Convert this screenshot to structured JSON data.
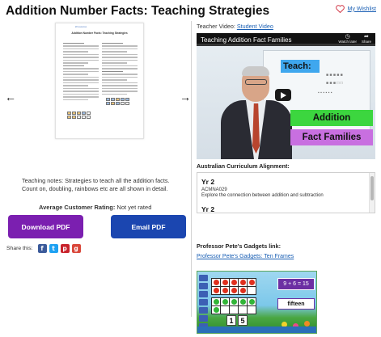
{
  "header": {
    "title": "Addition Number Facts: Teaching Strategies",
    "wishlist_label": "My Wishlist"
  },
  "preview": {
    "doc_link": "k8 resources",
    "doc_heading": "Addition Number Facts: Teaching Strategies",
    "prev_label": "◀",
    "next_label": "▶"
  },
  "description": "Teaching notes: Strategies to teach all the addition facts. Count on, doubling, rainbows etc are all shown in detail.",
  "rating": {
    "label": "Average Customer Rating:",
    "value": "Not yet rated"
  },
  "buttons": {
    "download_pdf": "Download PDF",
    "email_pdf": "Email PDF"
  },
  "share": {
    "label": "Share this:",
    "icons": [
      "facebook-icon",
      "twitter-icon",
      "pinterest-icon",
      "google-plus-icon"
    ]
  },
  "video": {
    "caption_prefix": "Teacher Video:",
    "student_link": "Student Video",
    "title": "Teaching Addition Fact Families",
    "watch_later": "Watch later",
    "share": "Share",
    "banner_teach": "Teach:",
    "label_addition": "Addition",
    "label_fact_families": "Fact Families"
  },
  "curriculum": {
    "title": "Australian Curriculum Alignment:",
    "entries": [
      {
        "year": "Yr 2",
        "code": "ACMNA029",
        "description": "Explore the connection between addition and subtraction"
      },
      {
        "year": "Yr 2"
      }
    ]
  },
  "gadgets": {
    "title": "Professor Pete's Gadgets link:",
    "link": "Professor Pete's Gadgets: Ten Frames",
    "equation": "9 + 6 = 15",
    "answer": "fifteen",
    "digits": [
      "1",
      "5"
    ]
  },
  "colors": {
    "download_button": "#7b1fb0",
    "email_button": "#1b46b0",
    "link": "#1a5fb4",
    "addition_label": "#3cd63f",
    "fact_families_label": "#c86fe0",
    "teach_banner": "#3fa7ee"
  }
}
